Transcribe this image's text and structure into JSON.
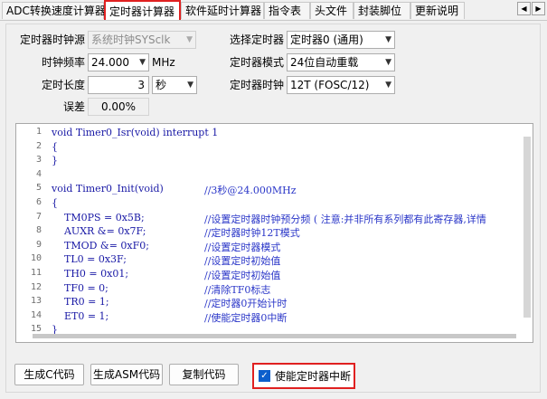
{
  "tabs": [
    {
      "label": "ADC转换速度计算器",
      "active": false
    },
    {
      "label": "定时器计算器",
      "active": true
    },
    {
      "label": "软件延时计算器",
      "active": false
    },
    {
      "label": "指令表",
      "active": false
    },
    {
      "label": "头文件",
      "active": false
    },
    {
      "label": "封装脚位",
      "active": false
    },
    {
      "label": "更新说明",
      "active": false
    }
  ],
  "tab_nav": {
    "prev": "◀",
    "next": "▶"
  },
  "form": {
    "clock_source_label": "定时器时钟源",
    "clock_source_value": "系统时钟SYSclk",
    "select_timer_label": "选择定时器",
    "select_timer_value": "定时器0 (通用)",
    "freq_label": "时钟频率",
    "freq_value": "24.000",
    "freq_unit": "MHz",
    "timer_mode_label": "定时器模式",
    "timer_mode_value": "24位自动重载",
    "length_label": "定时长度",
    "length_value": "3",
    "length_unit": "秒",
    "timer_clock_label": "定时器时钟",
    "timer_clock_value": "12T (FOSC/12)",
    "error_label": "误差",
    "error_value": "0.00%"
  },
  "code_lines": [
    {
      "n": "1",
      "code": "void Timer0_Isr(void) interrupt 1",
      "comment": ""
    },
    {
      "n": "2",
      "code": "{",
      "comment": ""
    },
    {
      "n": "3",
      "code": "}",
      "comment": ""
    },
    {
      "n": "4",
      "code": "",
      "comment": ""
    },
    {
      "n": "5",
      "code": "void Timer0_Init(void)",
      "comment": "//3秒@24.000MHz"
    },
    {
      "n": "6",
      "code": "{",
      "comment": ""
    },
    {
      "n": "7",
      "code": "    TM0PS = 0x5B;",
      "comment": "//设置定时器时钟预分频 ( 注意:并非所有系列都有此寄存器,详情"
    },
    {
      "n": "8",
      "code": "    AUXR &= 0x7F;",
      "comment": "//定时器时钟12T模式"
    },
    {
      "n": "9",
      "code": "    TMOD &= 0xF0;",
      "comment": "//设置定时器模式"
    },
    {
      "n": "10",
      "code": "    TL0 = 0x3F;",
      "comment": "//设置定时初始值"
    },
    {
      "n": "11",
      "code": "    TH0 = 0x01;",
      "comment": "//设置定时初始值"
    },
    {
      "n": "12",
      "code": "    TF0 = 0;",
      "comment": "//清除TF0标志"
    },
    {
      "n": "13",
      "code": "    TR0 = 1;",
      "comment": "//定时器0开始计时"
    },
    {
      "n": "14",
      "code": "    ET0 = 1;",
      "comment": "//使能定时器0中断"
    },
    {
      "n": "15",
      "code": "}",
      "comment": ""
    }
  ],
  "buttons": {
    "gen_c": "生成C代码",
    "gen_asm": "生成ASM代码",
    "copy": "复制代码"
  },
  "enable_interrupt": {
    "label": "使能定时器中断",
    "checked": true,
    "check_glyph": "✓"
  },
  "colors": {
    "highlight": "#e02020",
    "keyword": "#1a1aa6",
    "comment": "#2a36c8",
    "checkbox": "#0b5fcc"
  }
}
